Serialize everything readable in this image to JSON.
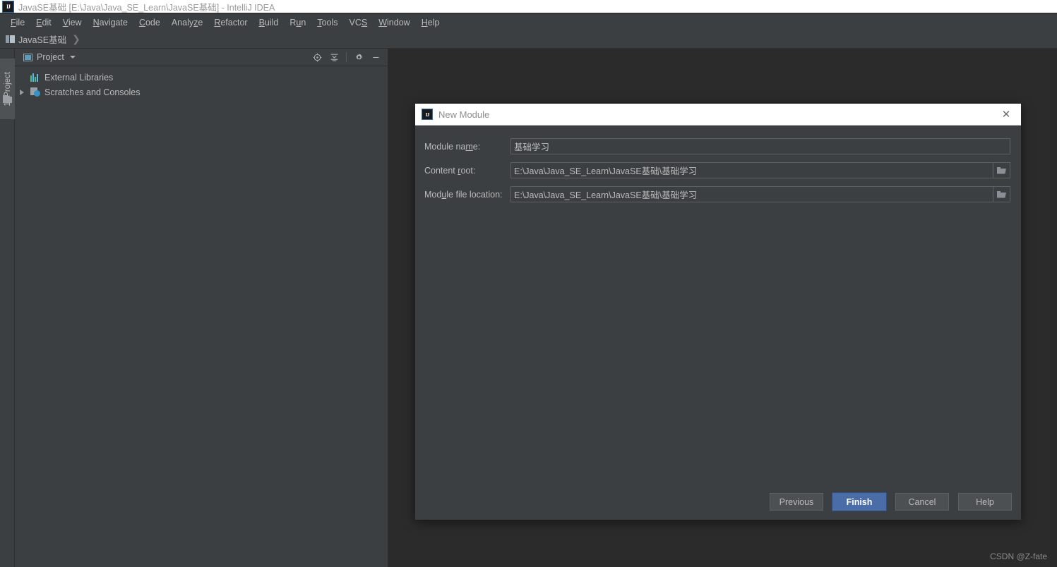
{
  "window": {
    "title": "JavaSE基础 [E:\\Java\\Java_SE_Learn\\JavaSE基础] - IntelliJ IDEA",
    "app_icon_label": "IJ"
  },
  "menubar": {
    "items": [
      {
        "pre": "",
        "mn": "F",
        "post": "ile"
      },
      {
        "pre": "",
        "mn": "E",
        "post": "dit"
      },
      {
        "pre": "",
        "mn": "V",
        "post": "iew"
      },
      {
        "pre": "",
        "mn": "N",
        "post": "avigate"
      },
      {
        "pre": "",
        "mn": "C",
        "post": "ode"
      },
      {
        "pre": "Analy",
        "mn": "z",
        "post": "e"
      },
      {
        "pre": "",
        "mn": "R",
        "post": "efactor"
      },
      {
        "pre": "",
        "mn": "B",
        "post": "uild"
      },
      {
        "pre": "R",
        "mn": "u",
        "post": "n"
      },
      {
        "pre": "",
        "mn": "T",
        "post": "ools"
      },
      {
        "pre": "VC",
        "mn": "S",
        "post": ""
      },
      {
        "pre": "",
        "mn": "W",
        "post": "indow"
      },
      {
        "pre": "",
        "mn": "H",
        "post": "elp"
      }
    ]
  },
  "navbar": {
    "crumb": "JavaSE基础",
    "separator": "❯"
  },
  "stripe": {
    "project_tab": "1: Project"
  },
  "tool_window": {
    "title": "Project",
    "actions": [
      {
        "name": "select-opened-file-icon"
      },
      {
        "name": "collapse-all-icon"
      },
      {
        "name": "settings-gear-icon"
      },
      {
        "name": "hide-icon"
      }
    ],
    "tree": [
      {
        "label": "External Libraries",
        "icon": "library-icon",
        "has_arrow": false
      },
      {
        "label": "Scratches and Consoles",
        "icon": "scratches-icon",
        "has_arrow": true
      }
    ]
  },
  "dialog": {
    "title": "New Module",
    "icon_label": "IJ",
    "close_icon": "✕",
    "fields": [
      {
        "label_pre": "Module na",
        "label_mn": "m",
        "label_post": "e:",
        "value": "基础学习",
        "browse": false
      },
      {
        "label_pre": "Content ",
        "label_mn": "r",
        "label_post": "oot:",
        "value": "E:\\Java\\Java_SE_Learn\\JavaSE基础\\基础学习",
        "browse": true
      },
      {
        "label_pre": "Mod",
        "label_mn": "u",
        "label_post": "le file location:",
        "value": "E:\\Java\\Java_SE_Learn\\JavaSE基础\\基础学习",
        "browse": true
      }
    ],
    "buttons": [
      {
        "label": "Previous",
        "primary": false
      },
      {
        "label": "Finish",
        "primary": true
      },
      {
        "label": "Cancel",
        "primary": false
      },
      {
        "label": "Help",
        "primary": false
      }
    ]
  },
  "watermark": "CSDN @Z-fate",
  "colors": {
    "editor_bg": "#2b2b2b",
    "panel_bg": "#3c3f41",
    "text": "#bbbbbb",
    "accent_blue": "#4a6da7",
    "titlebar_bg": "#ffffff"
  }
}
